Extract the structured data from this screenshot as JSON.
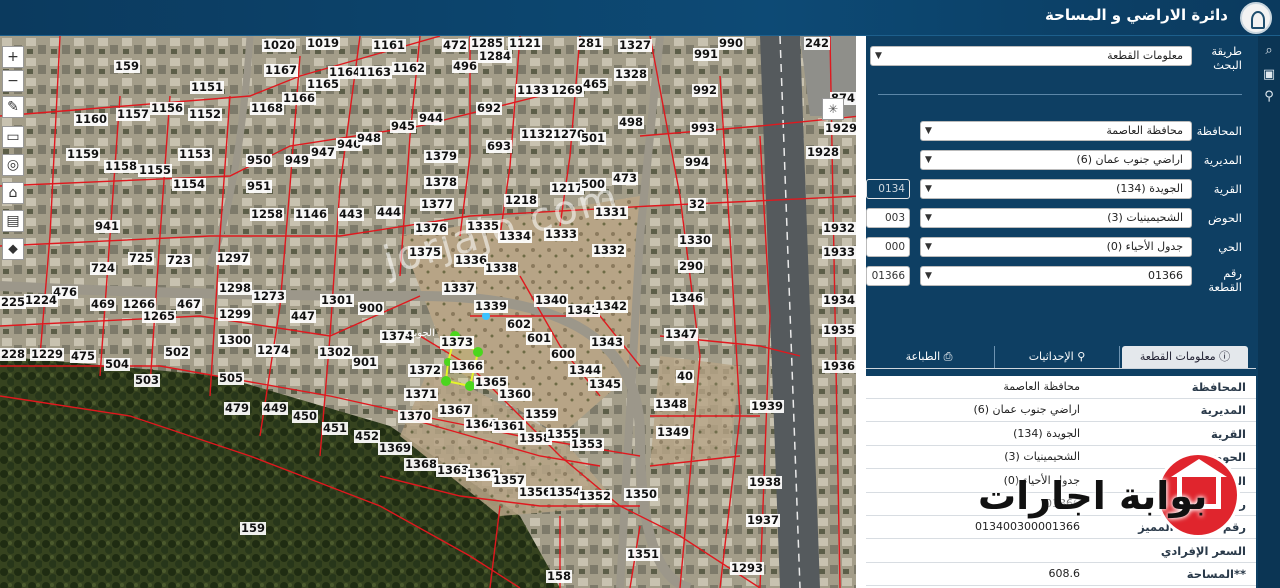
{
  "header": {
    "title": "دائرة الاراضي و المساحة"
  },
  "map": {
    "watermark": "jorjajo.com",
    "toolbar": [
      "+",
      "−",
      "✎",
      "▭",
      "◎",
      "⌂",
      "▤",
      "⬥"
    ],
    "street_label": "الجويدة",
    "plots": [
      [
        "159"
      ],
      [
        "1020"
      ],
      [
        "1019"
      ],
      [
        "1161"
      ],
      [
        "472"
      ],
      [
        "1285"
      ],
      [
        "1121"
      ],
      [
        "281"
      ],
      [
        "1327"
      ],
      [
        "990"
      ],
      [
        "242"
      ],
      [
        "1167"
      ],
      [
        "1164"
      ],
      [
        "1163"
      ],
      [
        "1162"
      ],
      [
        "496"
      ],
      [
        "1284"
      ],
      [
        "991"
      ],
      [
        "1328"
      ],
      [
        "1151"
      ],
      [
        "1165"
      ],
      [
        "1133"
      ],
      [
        "1269"
      ],
      [
        "465"
      ],
      [
        "992"
      ],
      [
        "874"
      ],
      [
        "1160"
      ],
      [
        "1157"
      ],
      [
        "1156"
      ],
      [
        "1152"
      ],
      [
        "1168"
      ],
      [
        "1166"
      ],
      [
        "692"
      ],
      [
        "944"
      ],
      [
        "498"
      ],
      [
        "1929"
      ],
      [
        "993"
      ],
      [
        "945"
      ],
      [
        "946"
      ],
      [
        "947"
      ],
      [
        "948"
      ],
      [
        "1132"
      ],
      [
        "1270"
      ],
      [
        "501"
      ],
      [
        "1159"
      ],
      [
        "1158"
      ],
      [
        "1155"
      ],
      [
        "1153"
      ],
      [
        "950"
      ],
      [
        "949"
      ],
      [
        "693"
      ],
      [
        "1379"
      ],
      [
        "1928"
      ],
      [
        "994"
      ],
      [
        "1154"
      ],
      [
        "951"
      ],
      [
        "1378"
      ],
      [
        "1217"
      ],
      [
        "500"
      ],
      [
        "473"
      ],
      [
        "1258"
      ],
      [
        "1146"
      ],
      [
        "443"
      ],
      [
        "444"
      ],
      [
        "1377"
      ],
      [
        "1218"
      ],
      [
        "1331"
      ],
      [
        "32"
      ],
      [
        "941"
      ],
      [
        "1376"
      ],
      [
        "1335"
      ],
      [
        "1334"
      ],
      [
        "1333"
      ],
      [
        "1330"
      ],
      [
        "1332"
      ],
      [
        "1932"
      ],
      [
        "1933"
      ],
      [
        "724"
      ],
      [
        "725"
      ],
      [
        "723"
      ],
      [
        "1297"
      ],
      [
        "1375"
      ],
      [
        "1336"
      ],
      [
        "1338"
      ],
      [
        "290"
      ],
      [
        "476"
      ],
      [
        "1224"
      ],
      [
        "225"
      ],
      [
        "469"
      ],
      [
        "1266"
      ],
      [
        "467"
      ],
      [
        "1265"
      ],
      [
        "1298"
      ],
      [
        "1273"
      ],
      [
        "1337"
      ],
      [
        "1346"
      ],
      [
        "1299"
      ],
      [
        "1301"
      ],
      [
        "900"
      ],
      [
        "1339"
      ],
      [
        "1340"
      ],
      [
        "1341"
      ],
      [
        "1342"
      ],
      [
        "1934"
      ],
      [
        "447"
      ],
      [
        "602"
      ],
      [
        "1347"
      ],
      [
        "1935"
      ],
      [
        "1300"
      ],
      [
        "1274"
      ],
      [
        "1302"
      ],
      [
        "1374"
      ],
      [
        "1373"
      ],
      [
        "601"
      ],
      [
        "1343"
      ],
      [
        "228"
      ],
      [
        "1229"
      ],
      [
        "475"
      ],
      [
        "504"
      ],
      [
        "502"
      ],
      [
        "901"
      ],
      [
        "1366"
      ],
      [
        "600"
      ],
      [
        "1936"
      ],
      [
        "503"
      ],
      [
        "1372"
      ],
      [
        "1365"
      ],
      [
        "1344"
      ],
      [
        "40"
      ],
      [
        "1345"
      ],
      [
        "505"
      ],
      [
        "1371"
      ],
      [
        "1360"
      ],
      [
        "1348"
      ],
      [
        "1939"
      ],
      [
        "479"
      ],
      [
        "449"
      ],
      [
        "450"
      ],
      [
        "1370"
      ],
      [
        "1367"
      ],
      [
        "1359"
      ],
      [
        "451"
      ],
      [
        "452"
      ],
      [
        "1364"
      ],
      [
        "1361"
      ],
      [
        "1358"
      ],
      [
        "1355"
      ],
      [
        "1353"
      ],
      [
        "1349"
      ],
      [
        "1369"
      ],
      [
        "1368"
      ],
      [
        "1363"
      ],
      [
        "1362"
      ],
      [
        "1357"
      ],
      [
        "1938"
      ],
      [
        "1356"
      ],
      [
        "1354"
      ],
      [
        "1352"
      ],
      [
        "1350"
      ],
      [
        "1937"
      ],
      [
        "159"
      ],
      [
        "1351"
      ],
      [
        "158"
      ],
      [
        "1293"
      ]
    ]
  },
  "panel": {
    "search_method_label": "طريقة البحث",
    "search_method_value": "معلومات القطعة",
    "governorate_label": "المحافظة",
    "governorate_value": "محافظة العاصمة",
    "directorate_label": "المديرية",
    "directorate_value": "اراضي جنوب عمان (6)",
    "village_label": "القرية",
    "village_value": "الجويدة (134)",
    "village_code": "0134",
    "basin_label": "الحوض",
    "basin_value": "الشحيمينيات (3)",
    "basin_code": "003",
    "district_label": "الحي",
    "district_value": "جدول الأحياء (0)",
    "district_code": "000",
    "plot_no_label": "رقم القطعة",
    "plot_no_value": "01366",
    "plot_no_code": "01366",
    "tabs": {
      "info": "معلومات القطعة",
      "coords": "الإحداثيات",
      "print": "الطباعة"
    },
    "info_rows": [
      {
        "key": "المحافظة",
        "value": "محافظة العاصمة"
      },
      {
        "key": "المديرية",
        "value": "اراضي جنوب عمان (6)"
      },
      {
        "key": "القرية",
        "value": "الجويدة (134)"
      },
      {
        "key": "الحوض",
        "value": "الشحيمينيات (3)"
      },
      {
        "key": "الحي",
        "value": "جدول الأحياء (0)"
      },
      {
        "key": "رقم القطعة",
        "value": "01366"
      },
      {
        "key": "رقم القطعة المميز",
        "value": "013400300001366"
      },
      {
        "key": "السعر الإفرادي",
        "value": ""
      },
      {
        "key": "**المساحة",
        "value": "608.6"
      }
    ]
  },
  "brand": {
    "text": "بوابة اجارات"
  }
}
